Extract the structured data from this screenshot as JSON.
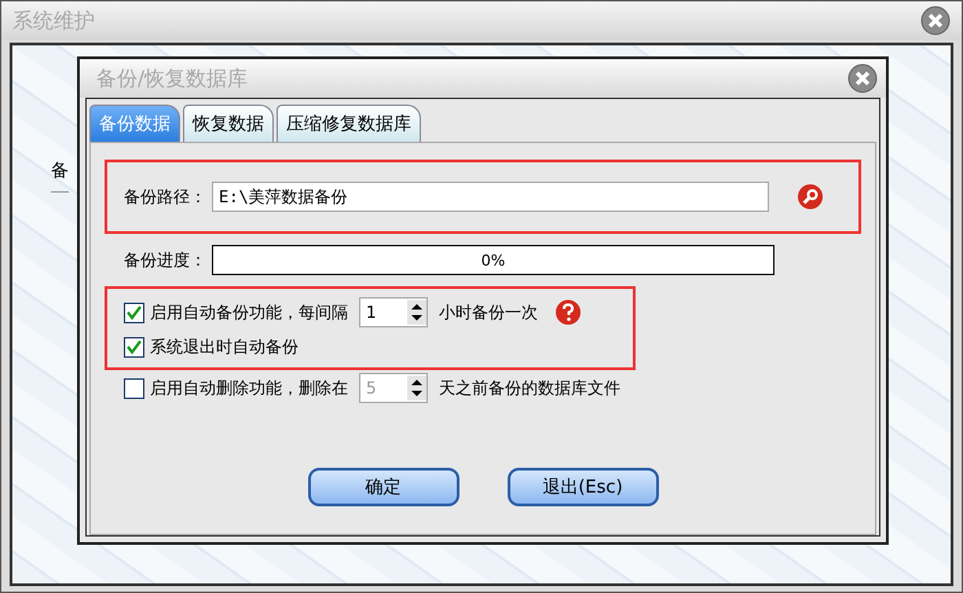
{
  "window": {
    "title": "系统维护",
    "background_text": "备"
  },
  "dialog": {
    "title": "备份/恢复数据库",
    "tabs": [
      {
        "label": "备份数据",
        "selected": true
      },
      {
        "label": "恢复数据",
        "selected": false
      },
      {
        "label": "压缩修复数据库",
        "selected": false
      }
    ],
    "path": {
      "label": "备份路径：",
      "value": "E:\\美萍数据备份"
    },
    "progress": {
      "label": "备份进度：",
      "level": 0,
      "reading": "0%"
    },
    "options": [
      {
        "label": "启用自动备份功能，每间隔",
        "checked": true,
        "spin": {
          "value": "1",
          "disabled": false
        },
        "suffix": "小时备份一次",
        "help": true,
        "framed": true
      },
      {
        "label": "系统退出时自动备份",
        "checked": true,
        "framed": true
      },
      {
        "label": "启用自动删除功能，删除在",
        "checked": false,
        "spin": {
          "value": "5",
          "disabled": true
        },
        "suffix": "天之前备份的数据库文件",
        "framed": false
      }
    ],
    "buttons": [
      "确定",
      "退出(Esc)"
    ]
  }
}
